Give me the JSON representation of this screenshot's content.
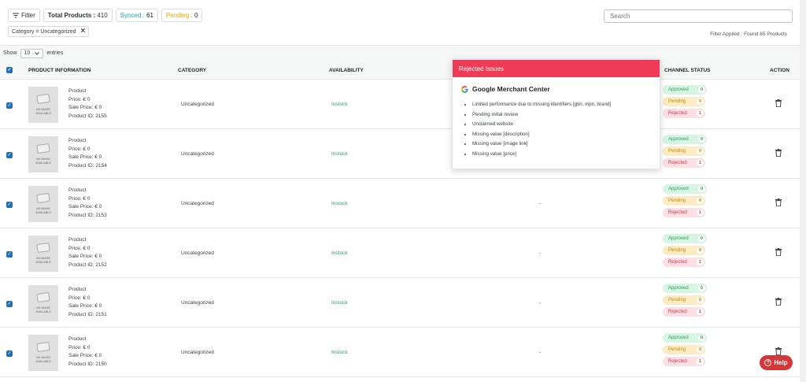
{
  "toolbar": {
    "filter_label": "Filter",
    "total_label": "Total Products :",
    "total_value": "410",
    "synced_label": "Synced :",
    "synced_value": "61",
    "pending_label": "Pending :",
    "pending_value": "0",
    "search_placeholder": "Search"
  },
  "active_filter": "Category = Uncategorized",
  "filter_applied": "Filter Applied : Found 65 Products",
  "show": {
    "prefix": "Show",
    "value": "10",
    "suffix": "entries"
  },
  "columns": {
    "product_information": "PRODUCT INFORMATION",
    "category": "CATEGORY",
    "availability": "AVAILABILITY",
    "channel_status": "CHANNEL STATUS",
    "action": "ACTION"
  },
  "no_image_text": "NO IMAGE AVAILABLE",
  "status_labels": {
    "approved": "Approved",
    "pending": "Pending",
    "rejected": "Rejected"
  },
  "rows": [
    {
      "name": "Product",
      "price": "Price: € 0",
      "sale_price": "Sale Price: € 0",
      "product_id": "Product ID: 2155",
      "category": "Uncategorized",
      "availability": "Instock",
      "issues": "",
      "approved": "0",
      "pending": "0",
      "rejected": "1"
    },
    {
      "name": "Product",
      "price": "Price: € 0",
      "sale_price": "Sale Price: € 0",
      "product_id": "Product ID: 2154",
      "category": "Uncategorized",
      "availability": "Instock",
      "issues": "",
      "approved": "0",
      "pending": "0",
      "rejected": "1"
    },
    {
      "name": "Product",
      "price": "Price: € 0",
      "sale_price": "Sale Price: € 0",
      "product_id": "Product ID: 2153",
      "category": "Uncategorized",
      "availability": "Instock",
      "issues": "-",
      "approved": "0",
      "pending": "0",
      "rejected": "1"
    },
    {
      "name": "Product",
      "price": "Price: € 0",
      "sale_price": "Sale Price: € 0",
      "product_id": "Product ID: 2152",
      "category": "Uncategorized",
      "availability": "Instock",
      "issues": "-",
      "approved": "0",
      "pending": "0",
      "rejected": "1"
    },
    {
      "name": "Product",
      "price": "Price: € 0",
      "sale_price": "Sale Price: € 0",
      "product_id": "Product ID: 2151",
      "category": "Uncategorized",
      "availability": "Instock",
      "issues": "-",
      "approved": "0",
      "pending": "0",
      "rejected": "1"
    },
    {
      "name": "Product",
      "price": "Price: € 0",
      "sale_price": "Sale Price: € 0",
      "product_id": "Product ID: 2150",
      "category": "Uncategorized",
      "availability": "Instock",
      "issues": "-",
      "approved": "0",
      "pending": "0",
      "rejected": "1"
    }
  ],
  "popup": {
    "title": "Rejected Issues",
    "channel": "Google Merchant Center",
    "issues": [
      "Limited performance due to missing identifiers [gtin, mpn, brand]",
      "Pending initial review",
      "Unclaimed website",
      "Missing value [description]",
      "Missing value [image link]",
      "Missing value [price]"
    ]
  },
  "help_label": "Help",
  "colors": {
    "accent": "#2271b1",
    "rejected_header": "#ef3b55",
    "help": "#d63638"
  }
}
